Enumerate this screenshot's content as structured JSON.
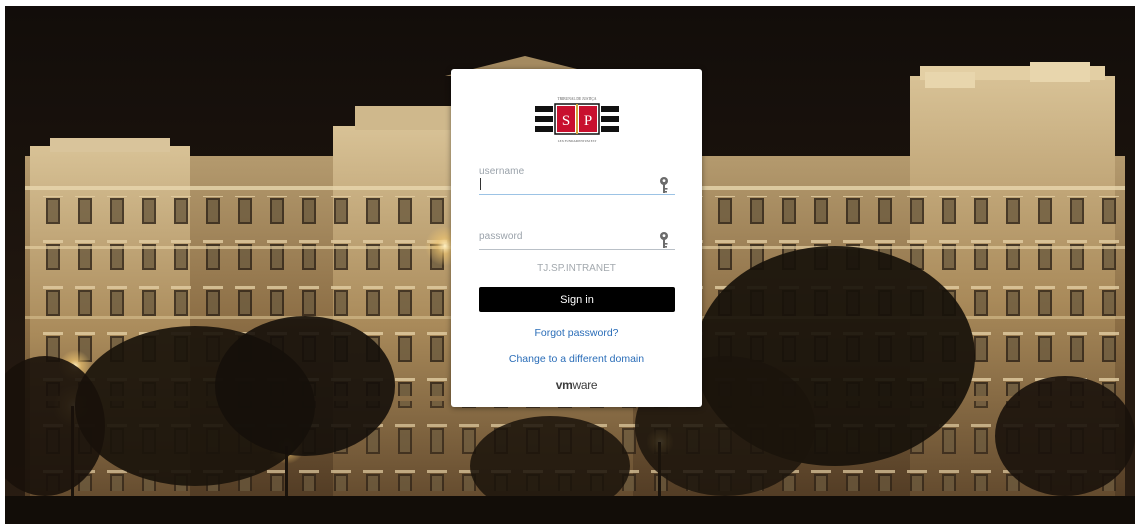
{
  "background": {
    "description_icon": "building-night-photo"
  },
  "logo": {
    "top_text": "TRIBUNAL DE JUSTIÇA",
    "letter_left": "S",
    "letter_right": "P",
    "bottom_text": "LEX FUNDAMENTUM EST",
    "icon": "tjsp-seal-icon"
  },
  "login": {
    "username": {
      "label": "username",
      "value": "",
      "icon": "key-icon"
    },
    "password": {
      "label": "password",
      "value": "",
      "icon": "key-icon"
    },
    "domain": "TJ.SP.INTRANET",
    "sign_in_label": "Sign in",
    "forgot_password": "Forgot password?",
    "change_domain": "Change to a different domain"
  },
  "branding": {
    "vendor_bold": "vm",
    "vendor_light": "ware"
  },
  "colors": {
    "accent_link": "#2a6db8",
    "button_bg": "#000000",
    "logo_red": "#c8102e"
  }
}
